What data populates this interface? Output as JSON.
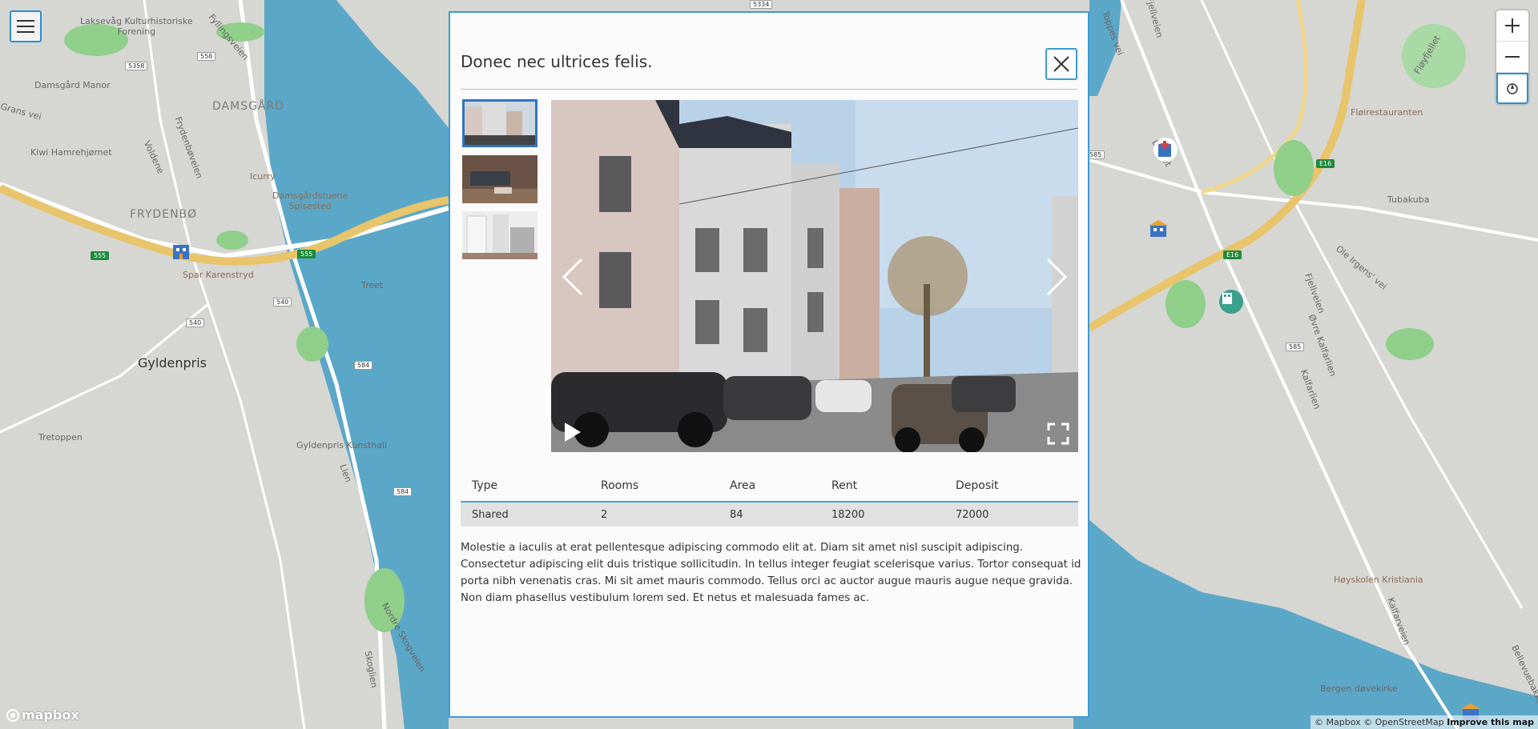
{
  "map": {
    "labels": {
      "laksevag": "Laksevåg Kulturhistoriske\nForening",
      "damsgard_manor": "Damsgård Manor",
      "damsgard": "DAMSGÅRD",
      "grans_vei": "Grans vei",
      "fyllingsveien": "Fyllingsveien",
      "frydenboveien": "Frydenbøveien",
      "kiwi": "Kiwi Hamrehjørnet",
      "voldene": "Voldene",
      "icurry": "Icurry",
      "damsgardstuene": "Damsgårdstuene\nSpisested",
      "frydenbo": "FRYDENBØ",
      "spar": "Spar Karenstryd",
      "treet": "Treet",
      "gyldenpris": "Gyldenpris",
      "tretoppen": "Tretoppen",
      "kunsthall": "Gyldenpris Kunsthall",
      "lien": "Lien",
      "nordre_skogveien": "Nordre Skogveien",
      "skoglien": "Skoglien",
      "fjellveien": "Fjellveien",
      "floirestauranten": "Fløirestauranten",
      "floyfjellet": "Fløyfjellet",
      "tubakuba": "Tubakuba",
      "ole_irgens": "Ole Irgens' vei",
      "fjellveien2": "Fjellveien",
      "ovre_kalfarlien": "Øvre Kalfarlien",
      "kalfarlien": "Kalfarlien",
      "hoyskolen": "Høyskolen Kristiania",
      "kalfarveien": "Kalfarveien",
      "bergen_dovekirke": "Bergen døvekirke",
      "bellevuebakken": "Bellevuebakken",
      "lokket": "Løkket",
      "toppes_vei": "Toppes vei"
    },
    "shields": {
      "s5358": "5358",
      "s558": "558",
      "s555a": "555",
      "s555b": "555",
      "s540a": "540",
      "s540b": "540",
      "s584a": "584",
      "s584b": "584",
      "s5334": "5334",
      "s585a": "585",
      "s585b": "585",
      "e16a": "E16",
      "e16b": "E16"
    },
    "attribution": "© Mapbox © OpenStreetMap",
    "improve": "Improve this map",
    "logo": "mapbox"
  },
  "modal": {
    "title": "Donec nec ultrices felis.",
    "table": {
      "headers": [
        "Type",
        "Rooms",
        "Area",
        "Rent",
        "Deposit"
      ],
      "row": [
        "Shared",
        "2",
        "84",
        "18200",
        "72000"
      ]
    },
    "description": "Molestie a iaculis at erat pellentesque adipiscing commodo elit at. Diam sit amet nisl suscipit adipiscing. Consectetur adipiscing elit duis tristique sollicitudin. In tellus integer feugiat scelerisque varius. Tortor consequat id porta nibh venenatis cras. Mi sit amet mauris commodo. Tellus orci ac auctor augue mauris augue neque gravida. Non diam phasellus vestibulum lorem sed. Et netus et malesuada fames ac."
  },
  "colors": {
    "accent": "#3b9bd4",
    "water": "#5ba7c8",
    "park": "#8fcf8a",
    "highway": "#e8c46a"
  }
}
